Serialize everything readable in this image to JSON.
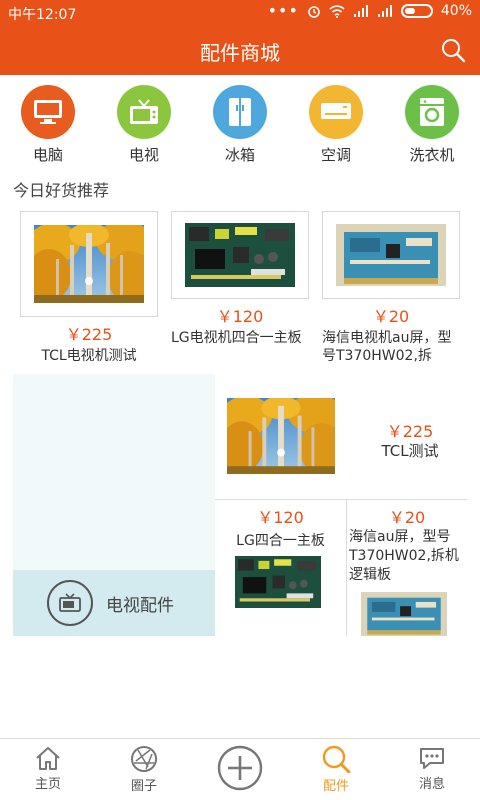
{
  "status_bar": {
    "time": "中午12:07",
    "dots": "•••",
    "battery": "40%"
  },
  "header": {
    "title": "配件商城"
  },
  "categories": [
    {
      "label": "电脑",
      "color": "#e85d1f",
      "icon": "monitor-icon"
    },
    {
      "label": "电视",
      "color": "#8cc63f",
      "icon": "tv-icon"
    },
    {
      "label": "冰箱",
      "color": "#4ea8de",
      "icon": "fridge-icon"
    },
    {
      "label": "空调",
      "color": "#f2b632",
      "icon": "air-conditioner-icon"
    },
    {
      "label": "洗衣机",
      "color": "#6cc04a",
      "icon": "washing-machine-icon"
    }
  ],
  "section_title": "今日好货推荐",
  "recommended": [
    {
      "price": "￥225",
      "name": "TCL电视机测试"
    },
    {
      "price": "￥120",
      "name": "LG电视机四合一主板"
    },
    {
      "price": "￥20",
      "name": "海信电视机au屏，型号T370HW02,拆"
    }
  ],
  "tv_parts": {
    "label": "电视配件",
    "featured": {
      "price": "￥225",
      "name": "TCL测试"
    },
    "items": [
      {
        "price": "￥120",
        "name": "LG四合一主板"
      },
      {
        "price": "￥20",
        "name": "海信au屏，型号T370HW02,拆机逻辑板"
      }
    ]
  },
  "tabs": [
    {
      "label": "主页",
      "icon": "home-icon"
    },
    {
      "label": "圈子",
      "icon": "aperture-icon"
    },
    {
      "label": "",
      "icon": "add-icon"
    },
    {
      "label": "配件",
      "icon": "search-icon",
      "active": true
    },
    {
      "label": "消息",
      "icon": "message-icon"
    }
  ],
  "colors": {
    "accent": "#e85118",
    "active_tab": "#f39a1e",
    "price": "#e85118"
  }
}
